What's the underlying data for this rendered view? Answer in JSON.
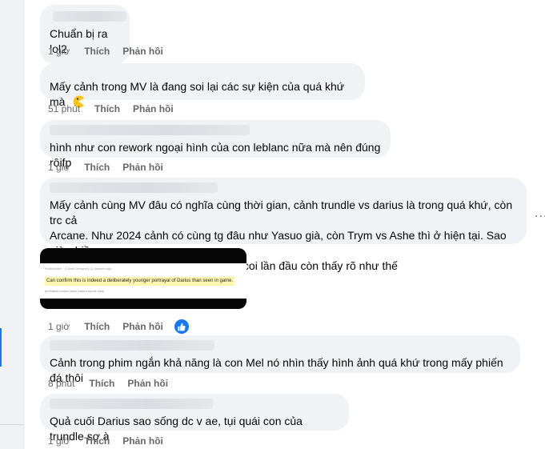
{
  "comments": [
    {
      "text": "Chuẩn bị ra lol2",
      "time": "1 giờ",
      "like_label": "Thích",
      "reply_label": "Phản hồi"
    },
    {
      "text": "Mấy cảnh trong MV là đang soi lại các sự kiện của quá khứ mà",
      "emoji": "pacman-emoji",
      "time": "51 phút",
      "like_label": "Thích",
      "reply_label": "Phản hồi"
    },
    {
      "text": "hình như con rework ngoại hình của con leblanc nữa mà nên đúng rôifp",
      "time": "1 giờ",
      "like_label": "Thích",
      "reply_label": "Phản hồi"
    },
    {
      "text_lines": [
        "Mấy cảnh cùng MV đâu có nghĩa cùng thời gian, cảnh trundle vs darius là trong quá khứ, còn trc cả",
        "Arcane. Như 2024 cảnh có cùng tg đâu như Yasuo già, còn Trym vs Ashe thì ở hiện tại. Sao giờ nhiều",
        "người coi ko dùng đc cái não trc ta, tôi coi lần đầu còn thấy rõ như thế"
      ],
      "time": "1 giờ",
      "like_label": "Thích",
      "reply_label": "Phản hồi",
      "more_label": "...",
      "reaction": "like-icon",
      "image": {
        "meta": "RiotMeddler  ·  [Game Designer] 11 minutes ago",
        "quote": "Can confirm this is indeed a deliberately younger portrayal of Darius than seen in game.",
        "links": "permalink   embed   save   parent   report   reply"
      }
    },
    {
      "text": "Cảnh trong phim ngắn khả năng là con Mel nó nhìn thấy hình ảnh quá khứ trong mấy phiến đá thôi",
      "time": "8 phút",
      "like_label": "Thích",
      "reply_label": "Phản hồi"
    },
    {
      "text": "Quả cuối Darius sao sống dc v ae, tụi quái con của trundle sợ à",
      "time": "1 giờ",
      "like_label": "Thích",
      "reply_label": "Phản hồi"
    }
  ],
  "colors": {
    "bubble": "#f0f2f5",
    "meta": "#65676b",
    "accent": "#1877f2",
    "highlight": "#fff7b0"
  }
}
